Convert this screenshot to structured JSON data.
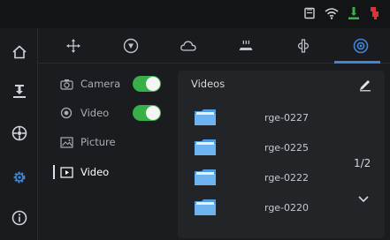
{
  "status_bar": {
    "icons": [
      "sd-card-icon",
      "wifi-icon",
      "printer-status-icon",
      "usb-icon"
    ],
    "colors": {
      "printer_status": "#37b34a",
      "usb": "#d8353a"
    }
  },
  "sidebar": {
    "items": [
      {
        "icon": "home-icon"
      },
      {
        "icon": "print-head-icon"
      },
      {
        "icon": "filament-spool-icon"
      },
      {
        "icon": "settings-gear-icon",
        "active": true
      },
      {
        "icon": "info-icon"
      }
    ]
  },
  "tabs": [
    {
      "icon": "move-axes-icon"
    },
    {
      "icon": "nozzle-icon"
    },
    {
      "icon": "cloud-icon"
    },
    {
      "icon": "heatbed-icon"
    },
    {
      "icon": "fan-icon"
    },
    {
      "icon": "camera-lens-icon",
      "active": true
    }
  ],
  "menu": {
    "items": [
      {
        "label": "Camera",
        "icon": "camera-icon",
        "toggle": true,
        "on": true
      },
      {
        "label": "Video",
        "icon": "video-record-icon",
        "toggle": true,
        "on": true
      },
      {
        "label": "Picture",
        "icon": "picture-icon"
      },
      {
        "label": "Video",
        "icon": "video-play-icon",
        "active": true
      }
    ]
  },
  "panel": {
    "title": "Videos",
    "files": [
      "rge-0227",
      "rge-0225",
      "rge-0222",
      "rge-0220"
    ],
    "page": "1/2"
  },
  "colors": {
    "accent": "#3f86d8",
    "toggle_on": "#3aae48",
    "folder": "#4d9be0"
  }
}
